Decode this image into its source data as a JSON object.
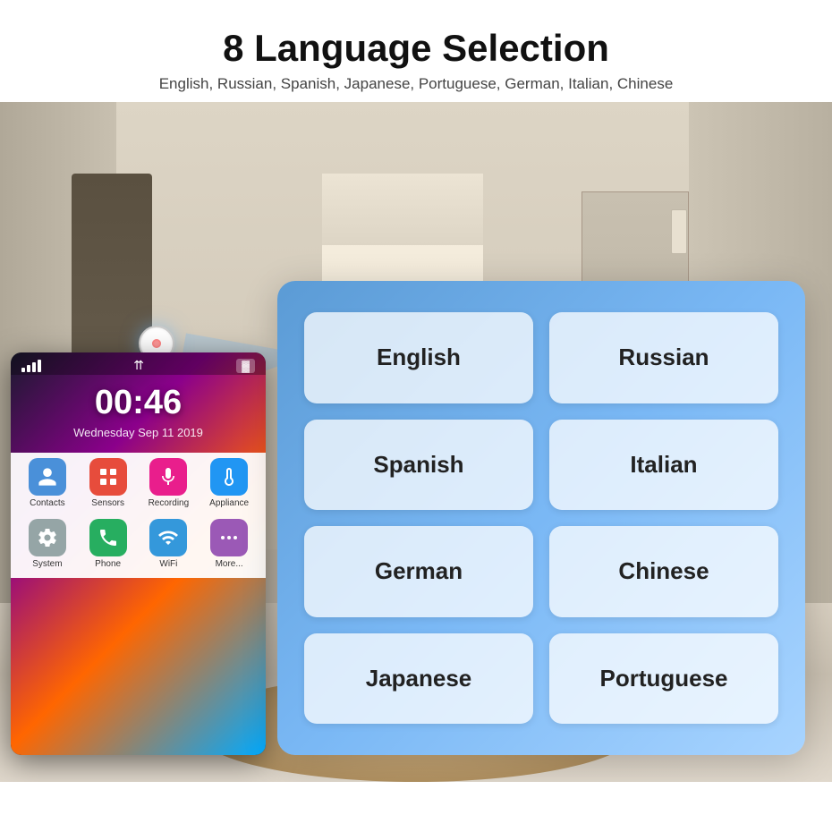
{
  "header": {
    "title": "8 Language Selection",
    "subtitle": "English, Russian, Spanish, Japanese, Portuguese, German, Italian, Chinese"
  },
  "phone": {
    "time": "00:46",
    "date": "Wednesday    Sep 11 2019",
    "apps_row1": [
      {
        "label": "Contacts",
        "color": "#4a90d9",
        "icon": "👤"
      },
      {
        "label": "Sensors",
        "color": "#e74c3c",
        "icon": "⊞"
      },
      {
        "label": "Recording",
        "color": "#e91e8c",
        "icon": "🎤"
      },
      {
        "label": "Appliance",
        "color": "#2196F3",
        "icon": "🌡"
      }
    ],
    "apps_row2": [
      {
        "label": "System",
        "color": "#95a5a6",
        "icon": "⚙"
      },
      {
        "label": "Phone",
        "color": "#27ae60",
        "icon": "📞"
      },
      {
        "label": "WiFi",
        "color": "#3498db",
        "icon": "📶"
      },
      {
        "label": "More...",
        "color": "#9b59b6",
        "icon": "•••"
      }
    ]
  },
  "languages": {
    "buttons": [
      {
        "label": "English",
        "col": 1,
        "row": 1
      },
      {
        "label": "Russian",
        "col": 2,
        "row": 1
      },
      {
        "label": "Spanish",
        "col": 1,
        "row": 2
      },
      {
        "label": "Italian",
        "col": 2,
        "row": 2
      },
      {
        "label": "German",
        "col": 1,
        "row": 3
      },
      {
        "label": "Chinese",
        "col": 2,
        "row": 3
      },
      {
        "label": "Japanese",
        "col": 1,
        "row": 4
      },
      {
        "label": "Portuguese",
        "col": 2,
        "row": 4
      }
    ]
  }
}
